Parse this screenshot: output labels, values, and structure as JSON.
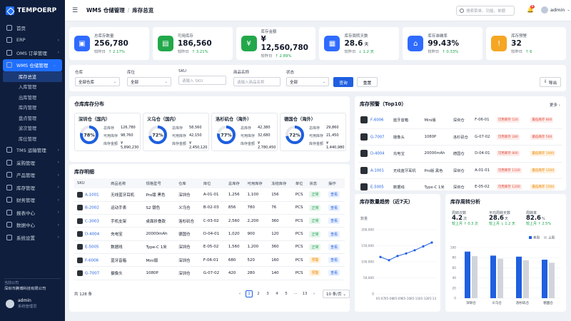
{
  "app": {
    "logo": "TEMPOERP"
  },
  "sidebar": {
    "items": [
      {
        "label": "首页",
        "chev": ""
      },
      {
        "label": "ERP",
        "chev": "›"
      },
      {
        "label": "OMS 订单管理",
        "chev": "›"
      },
      {
        "label": "WMS 仓储管理",
        "chev": "⌄"
      }
    ],
    "sub": [
      "库存总览",
      "入库管理",
      "出库管理",
      "库内管理",
      "盘点管理",
      "波次管理",
      "库位管理"
    ],
    "items2": [
      {
        "label": "TMS 运输管理",
        "chev": "›"
      },
      {
        "label": "采购管理",
        "chev": "›"
      },
      {
        "label": "产品管理",
        "chev": "›"
      },
      {
        "label": "库存管理",
        "chev": "›"
      },
      {
        "label": "财务管理",
        "chev": "›"
      },
      {
        "label": "报表中心",
        "chev": "›"
      },
      {
        "label": "数据中心",
        "chev": "›"
      },
      {
        "label": "系统设置",
        "chev": "›"
      }
    ],
    "company_label": "当前公司",
    "company_value": "深圳市腾博科技有限公司",
    "user_name": "admin",
    "user_role": "系统管理员"
  },
  "topbar": {
    "module": "WMS 仓储管理",
    "page": "库存总览",
    "search_placeholder": "搜索菜单、功能、单据",
    "badge": "8",
    "user": "admin"
  },
  "kpis": [
    {
      "label": "总库存数量",
      "value": "256,780",
      "cmp": "较昨日",
      "delta": "↑ 2.17%",
      "color": "#2f6bff",
      "icon": "▣"
    },
    {
      "label": "可用库存",
      "value": "186,560",
      "cmp": "较昨日",
      "delta": "↑ 3.21%",
      "color": "#22a84a",
      "icon": "▤"
    },
    {
      "label": "库存金额",
      "value": "¥ 12,560,780",
      "cmp": "较昨日",
      "delta": "↑ 2.89%",
      "color": "#22a84a",
      "icon": "¥"
    },
    {
      "label": "库存周转天数",
      "value": "28.6",
      "unit": "天",
      "cmp": "较昨日",
      "delta": "↓ 1.2 天",
      "color": "#2f6bff",
      "icon": "▦"
    },
    {
      "label": "库存准确率",
      "value": "99.43%",
      "cmp": "较昨日",
      "delta": "↑ 0.33%",
      "color": "#2f6bff",
      "icon": "⌂"
    },
    {
      "label": "库存预警",
      "value": "32",
      "cmp": "较昨日",
      "delta": "↑ 6",
      "color": "#f5a623",
      "icon": "!"
    }
  ],
  "filters": {
    "warehouse": {
      "label": "仓库",
      "value": "全部仓库"
    },
    "zone": {
      "label": "库位",
      "value": "全部"
    },
    "sku": {
      "label": "SKU",
      "placeholder": "请输入 SKU"
    },
    "name": {
      "label": "商品名称",
      "placeholder": "请输入商品名称"
    },
    "status": {
      "label": "状态",
      "value": "全部"
    },
    "query": "查询",
    "reset": "重置",
    "export": "导出"
  },
  "distribution": {
    "title": "仓库库存分布",
    "labels": {
      "total": "总库存",
      "avail": "可用库存",
      "amount": "库存金额"
    },
    "warehouses": [
      {
        "name": "深圳仓（国内）",
        "pct": 78,
        "pct_label": "78%",
        "total": "126,780",
        "avail": "98,760",
        "amount": "¥ 5,890,230"
      },
      {
        "name": "义乌仓（国内）",
        "pct": 72,
        "pct_label": "72%",
        "total": "58,560",
        "avail": "42,150",
        "amount": "¥ 2,450,120"
      },
      {
        "name": "洛杉矶仓（海外）",
        "pct": 77,
        "pct_label": "77%",
        "total": "42,380",
        "avail": "32,680",
        "amount": "¥ 2,780,450"
      },
      {
        "name": "德国仓（海外）",
        "pct": 72,
        "pct_label": "72%",
        "total": "29,860",
        "avail": "21,450",
        "amount": "¥ 1,440,980"
      }
    ]
  },
  "inventory": {
    "title": "库存明细",
    "columns": [
      "SKU",
      "商品名称",
      "规格型号",
      "仓库",
      "库位",
      "总库存",
      "可用库存",
      "冻结库存",
      "单位",
      "状态",
      "操作"
    ],
    "rows": [
      [
        "A-1001",
        "无线蓝牙耳机",
        "Pro版 黑色",
        "深圳仓",
        "A-01-01",
        "1,256",
        "1,100",
        "156",
        "PCS",
        "正常",
        "查看"
      ],
      [
        "B-2002",
        "运动手表",
        "S2 银色",
        "义乌仓",
        "B-02-03",
        "856",
        "780",
        "76",
        "PCS",
        "正常",
        "查看"
      ],
      [
        "C-3003",
        "手机支架",
        "桌面折叠款",
        "洛杉矶仓",
        "C-03-02",
        "2,560",
        "2,200",
        "360",
        "PCS",
        "正常",
        "查看"
      ],
      [
        "D-4004",
        "充电宝",
        "20000mAh",
        "德国仓",
        "D-04-01",
        "1,020",
        "900",
        "120",
        "PCS",
        "正常",
        "查看"
      ],
      [
        "E-5005",
        "数据线",
        "Type-C 1米",
        "深圳仓",
        "E-05-02",
        "1,560",
        "1,200",
        "360",
        "PCS",
        "正常",
        "查看"
      ],
      [
        "F-6006",
        "蓝牙音箱",
        "Mini版",
        "深圳仓",
        "F-06-01",
        "680",
        "520",
        "160",
        "PCS",
        "预警",
        "查看"
      ],
      [
        "G-7007",
        "摄像头",
        "1080P",
        "深圳仓",
        "G-07-02",
        "420",
        "280",
        "140",
        "PCS",
        "预警",
        "查看"
      ]
    ],
    "total": "共 128 条",
    "pages": [
      "‹",
      "1",
      "2",
      "3",
      "4",
      "5",
      "···",
      "13",
      "›"
    ],
    "page_size": "10 条/页"
  },
  "alerts": {
    "title": "库存预警（Top10）",
    "more": "更多 ›",
    "rows": [
      [
        "F-6006",
        "蓝牙音箱",
        "Mini版",
        "深圳仓",
        "F-06-01",
        "可用库存 520",
        "最低库存 800",
        "red"
      ],
      [
        "G-7007",
        "摄像头",
        "1080P",
        "洛杉矶仓",
        "G-07-02",
        "可用库存 280",
        "最低库存 500",
        "red"
      ],
      [
        "D-4004",
        "充电宝",
        "20000mAh",
        "德国仓",
        "D-04-01",
        "可用库存 900",
        "最低库存 1000",
        "orange"
      ],
      [
        "A-1001",
        "无线蓝牙耳机",
        "Pro版 黑色",
        "深圳仓",
        "A-01-01",
        "可用库存 1100",
        "最低库存 1500",
        "orange"
      ],
      [
        "E-5005",
        "数据线",
        "Type-C 1米",
        "深圳仓",
        "E-05-02",
        "可用库存 1200",
        "最低库存 1500",
        "orange"
      ]
    ]
  },
  "trend": {
    "title": "库存数量趋势（近7天）",
    "unit": "数量"
  },
  "turnover": {
    "title": "库存周转分析",
    "stats": [
      {
        "label": "周转次数",
        "value": "4.2",
        "unit": "次",
        "delta": "较上月 ↑ 0.3 次"
      },
      {
        "label": "平均周转天数",
        "value": "28.6",
        "unit": "天",
        "delta": "较上月 ↓ 1.2 天"
      },
      {
        "label": "周转率",
        "value": "82.6",
        "unit": "%",
        "delta": "较上月 ↑ 2.5%"
      }
    ]
  },
  "chart_data": [
    {
      "type": "line",
      "title": "库存数量趋势（近7天）",
      "ylabel": "数量",
      "x": [
        "05-07",
        "05-08",
        "05-09",
        "05-10",
        "05-11",
        "05-12",
        "05-13"
      ],
      "yticks": [
        "200,000",
        "150,000",
        "100,000",
        "50,000",
        "0"
      ],
      "ylim": [
        0,
        200000
      ],
      "grid": true,
      "series": [
        {
          "values": [
            115000,
            105000,
            118000,
            126000,
            136000,
            148000,
            160000
          ]
        }
      ]
    },
    {
      "type": "bar",
      "title": "库存周转分析",
      "categories": [
        "深圳仓",
        "义乌仓",
        "洛杉矶仓",
        "德国仓"
      ],
      "yticks": [
        "100",
        "80",
        "60",
        "40",
        "20",
        "0"
      ],
      "ylim": [
        0,
        100
      ],
      "legend": "top-right",
      "series": [
        {
          "name": "本周",
          "color": "#1f5fe0",
          "values": [
            92,
            84,
            82,
            76
          ]
        },
        {
          "name": "上周",
          "color": "#d1d5db",
          "values": [
            83,
            78,
            75,
            70
          ]
        }
      ]
    }
  ]
}
